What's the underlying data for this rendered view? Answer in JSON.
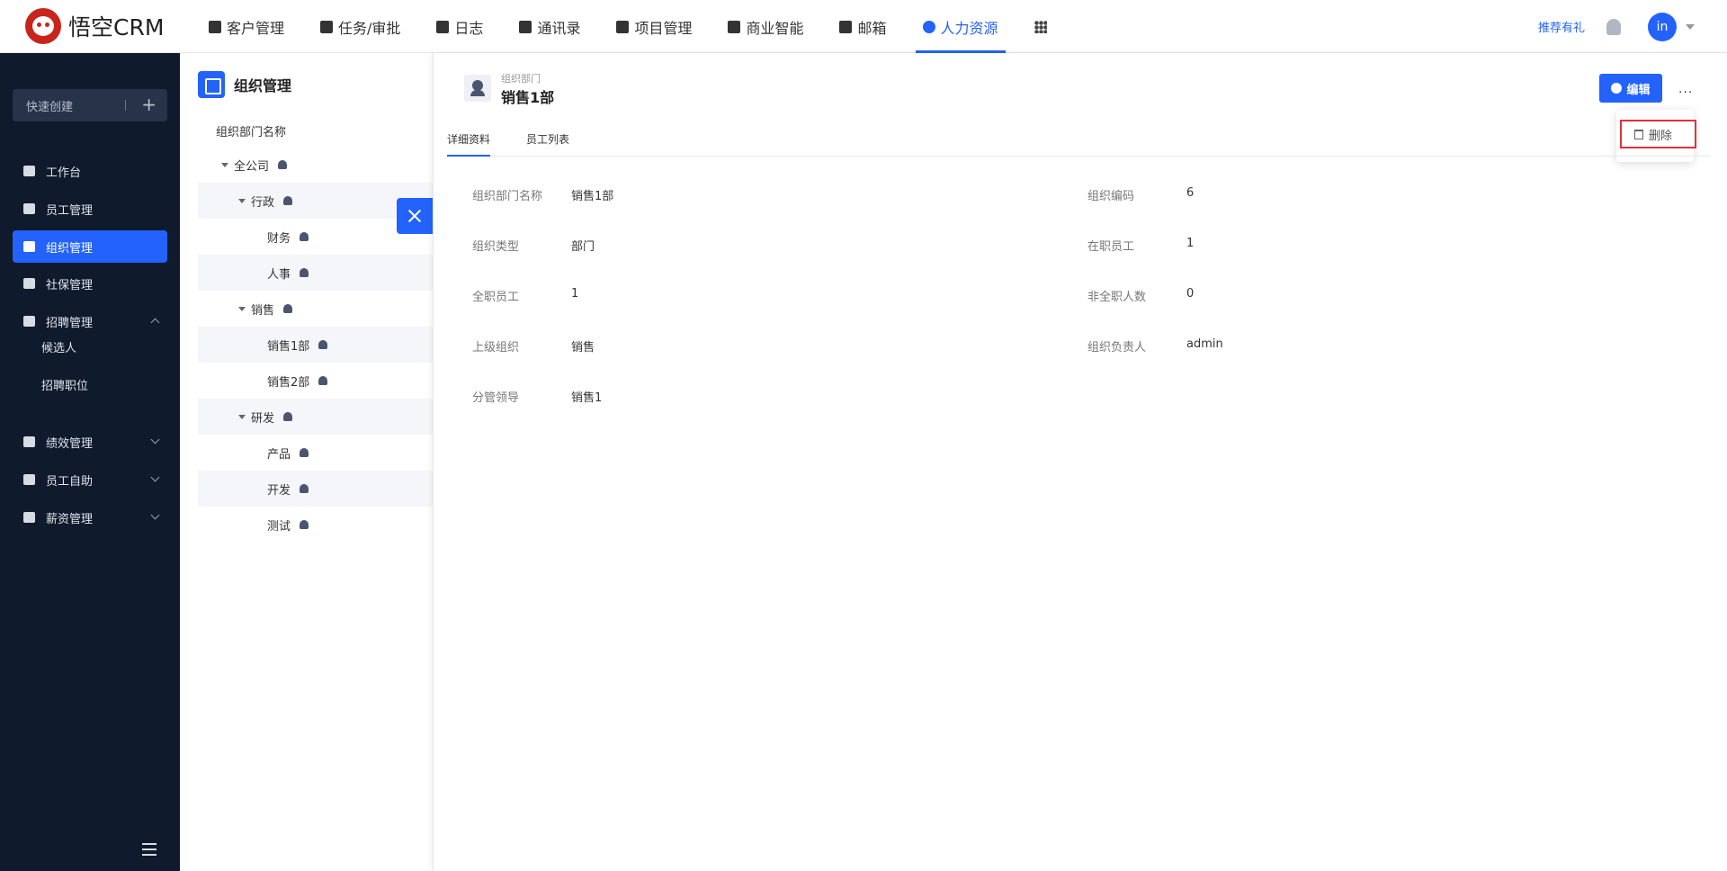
{
  "app": {
    "logo_text": "悟空CRM",
    "menu": [
      {
        "label": "客户管理",
        "icon": "building-icon"
      },
      {
        "label": "任务/审批",
        "icon": "briefcase-icon"
      },
      {
        "label": "日志",
        "icon": "notebook-icon"
      },
      {
        "label": "通讯录",
        "icon": "phone-book-icon"
      },
      {
        "label": "项目管理",
        "icon": "list-icon"
      },
      {
        "label": "商业智能",
        "icon": "shield-check-icon"
      },
      {
        "label": "邮箱",
        "icon": "mail-icon"
      },
      {
        "label": "人力资源",
        "icon": "people-icon"
      }
    ],
    "active_menu": "人力资源",
    "recommend": "推荐有礼",
    "avatar": "in",
    "accent": "#2362fb"
  },
  "sidebar": {
    "quick_create": "快速创建",
    "items": [
      {
        "label": "工作台"
      },
      {
        "label": "员工管理"
      },
      {
        "label": "组织管理"
      },
      {
        "label": "社保管理"
      },
      {
        "label": "招聘管理"
      },
      {
        "label": "绩效管理"
      },
      {
        "label": "员工自助"
      },
      {
        "label": "薪资管理"
      }
    ],
    "sub_items": [
      "候选人",
      "招聘职位"
    ]
  },
  "org": {
    "title": "组织管理",
    "column": "组织部门名称",
    "tree": [
      {
        "label": "全公司"
      },
      {
        "label": "行政"
      },
      {
        "label": "财务"
      },
      {
        "label": "人事"
      },
      {
        "label": "销售"
      },
      {
        "label": "销售1部"
      },
      {
        "label": "销售2部"
      },
      {
        "label": "研发"
      },
      {
        "label": "产品"
      },
      {
        "label": "开发"
      },
      {
        "label": "测试"
      }
    ]
  },
  "detail": {
    "subtitle": "组织部门",
    "title": "销售1部",
    "edit": "编辑",
    "more": "···",
    "delete": "删除",
    "tabs": [
      "详细资料",
      "员工列表"
    ],
    "fields": [
      {
        "label": "组织部门名称",
        "value": "销售1部"
      },
      {
        "label": "组织编码",
        "value": "6"
      },
      {
        "label": "组织类型",
        "value": "部门"
      },
      {
        "label": "在职员工",
        "value": "1"
      },
      {
        "label": "全职员工",
        "value": "1"
      },
      {
        "label": "非全职人数",
        "value": "0"
      },
      {
        "label": "上级组织",
        "value": "销售"
      },
      {
        "label": "组织负责人",
        "value": "admin"
      },
      {
        "label": "分管领导",
        "value": "销售1"
      }
    ]
  }
}
